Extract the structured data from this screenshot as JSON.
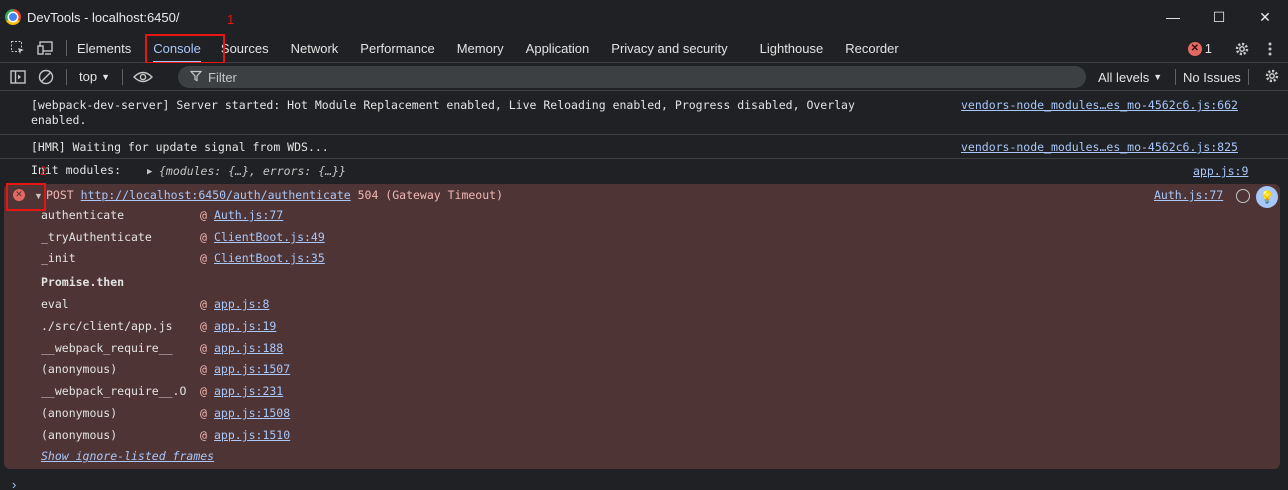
{
  "window": {
    "title": "DevTools - localhost:6450/",
    "minimize": "—",
    "maximize": "☐",
    "close": "✕"
  },
  "tabs": [
    {
      "label": "Elements"
    },
    {
      "label": "Console"
    },
    {
      "label": "Sources"
    },
    {
      "label": "Network"
    },
    {
      "label": "Performance"
    },
    {
      "label": "Memory"
    },
    {
      "label": "Application"
    },
    {
      "label": "Privacy and security"
    },
    {
      "label": "Lighthouse"
    },
    {
      "label": "Recorder"
    }
  ],
  "issues_badge": {
    "count": "1"
  },
  "annotations": {
    "tab_marker": "1",
    "icon_marker": "2"
  },
  "toolbar": {
    "context": "top",
    "filter_placeholder": "Filter",
    "levels": "All levels",
    "issues": "No Issues"
  },
  "messages": [
    {
      "text": "[webpack-dev-server] Server started: Hot Module Replacement enabled, Live Reloading enabled, Progress disabled, Overlay\nenabled.",
      "source": "vendors-node_modules…es_mo-4562c6.js:662"
    },
    {
      "text": "[HMR] Waiting for update signal from WDS...",
      "source": "vendors-node_modules…es_mo-4562c6.js:825"
    },
    {
      "text": "Init modules:",
      "object_preview": "{modules: {…}, errors: {…}}",
      "source": "app.js:9"
    }
  ],
  "error": {
    "method": "POST",
    "url": "http://localhost:6450/auth/authenticate",
    "status": "504 (Gateway Timeout)",
    "source": "Auth.js:77",
    "stack": [
      {
        "fn": "authenticate",
        "at": "@",
        "link": "Auth.js:77"
      },
      {
        "fn": "_tryAuthenticate",
        "at": "@",
        "link": "ClientBoot.js:49"
      },
      {
        "fn": "_init",
        "at": "@",
        "link": "ClientBoot.js:35"
      },
      {
        "fn": "Promise.then",
        "at": "",
        "link": ""
      },
      {
        "fn": "eval",
        "at": "@",
        "link": "app.js:8"
      },
      {
        "fn": "./src/client/app.js",
        "at": "@",
        "link": "app.js:19"
      },
      {
        "fn": "__webpack_require__",
        "at": "@",
        "link": "app.js:188"
      },
      {
        "fn": "(anonymous)",
        "at": "@",
        "link": "app.js:1507"
      },
      {
        "fn": "__webpack_require__.O",
        "at": "@",
        "link": "app.js:231"
      },
      {
        "fn": "(anonymous)",
        "at": "@",
        "link": "app.js:1508"
      },
      {
        "fn": "(anonymous)",
        "at": "@",
        "link": "app.js:1510"
      }
    ],
    "show_ignored": "Show ignore-listed frames"
  }
}
